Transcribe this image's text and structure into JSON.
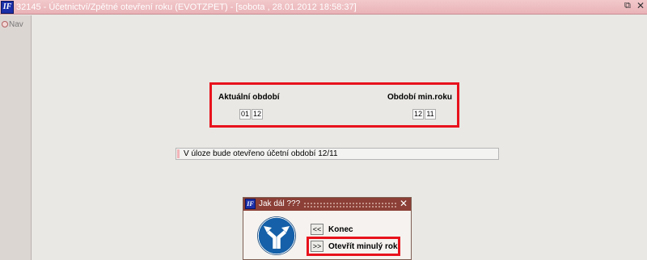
{
  "window": {
    "logo_text": "IF",
    "title": "32145 - Účetnictví/Zpětné otevření roku (EVOTZPET) - [sobota , 28.01.2012 18:58:37]",
    "restore_glyph": "⧉",
    "close_glyph": "✕"
  },
  "sidebar": {
    "nav_label": "Nav"
  },
  "periods": {
    "current_label": "Aktuální období",
    "current_month": "01",
    "current_year": "12",
    "min_label": "Období min.roku",
    "min_month": "12",
    "min_year": "11"
  },
  "info": {
    "text": "V úloze bude otevřeno účetní období 12/11"
  },
  "dialog": {
    "logo_text": "IF",
    "title": "Jak dál ???",
    "close_glyph": "✕",
    "icon": "direction-fork-icon",
    "end_button": "<<",
    "end_label": "Konec",
    "open_button": ">>",
    "open_label": "Otevřít minulý rok"
  },
  "colors": {
    "titlebar": "#e9b2b6",
    "dialog_titlebar": "#8b3f36",
    "highlight": "#e8121c",
    "sign_blue": "#1560a8"
  }
}
